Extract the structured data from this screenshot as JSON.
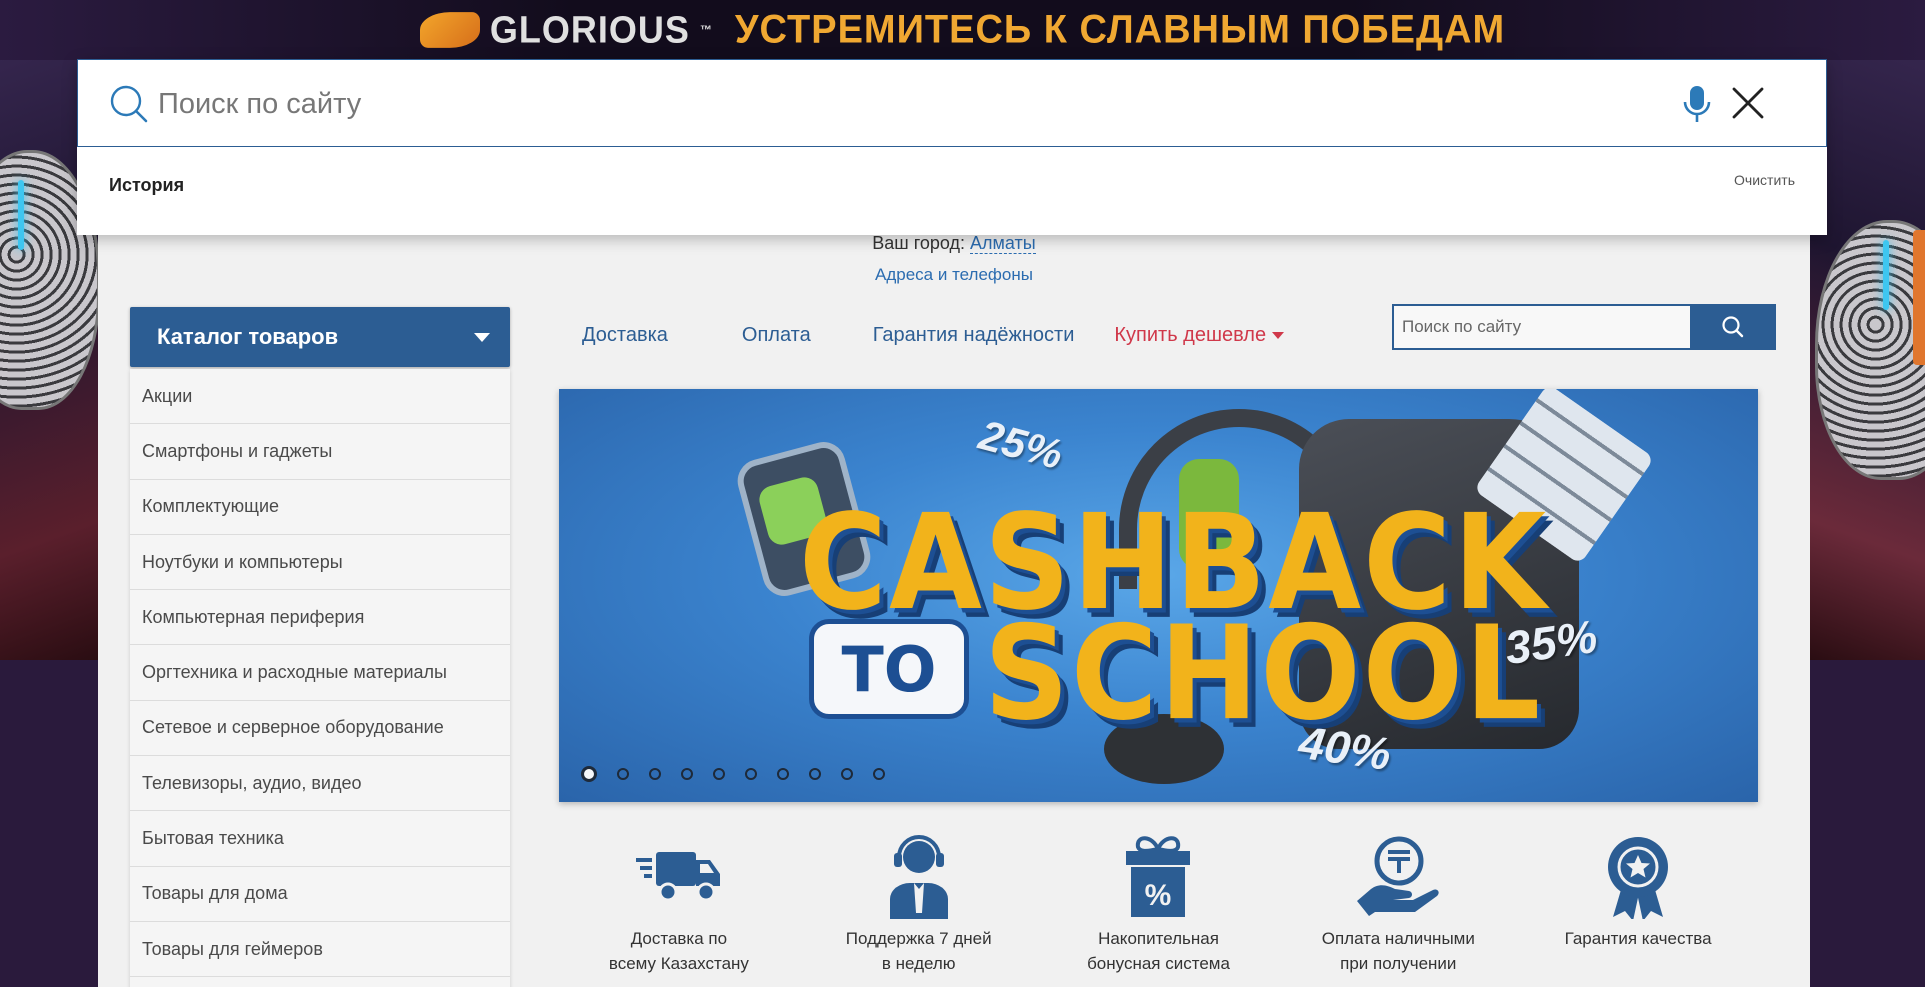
{
  "promo_banner": {
    "brand": "GLORIOUS",
    "trademark": "™",
    "slogan": "УСТРЕМИТЕСЬ К СЛАВНЫМ ПОБЕДАМ"
  },
  "search_overlay": {
    "placeholder": "Поиск по сайту",
    "value": "",
    "history_label": "История",
    "clear_label": "Очистить",
    "icons": [
      "search-icon",
      "microphone-icon",
      "close-icon"
    ]
  },
  "header": {
    "city_prefix": "Ваш город:",
    "city_name": "Алматы",
    "addresses_link": "Адреса и телефоны"
  },
  "catalog": {
    "button_label": "Каталог товаров",
    "items": [
      "Акции",
      "Смартфоны и гаджеты",
      "Комплектующие",
      "Ноутбуки и компьютеры",
      "Компьютерная периферия",
      "Оргтехника и расходные материалы",
      "Сетевое и серверное оборудование",
      "Телевизоры, аудио, видео",
      "Бытовая техника",
      "Товары для дома",
      "Товары для геймеров"
    ]
  },
  "nav": {
    "delivery": "Доставка",
    "payment": "Оплата",
    "guarantee": "Гарантия надёжности",
    "buy_cheaper": "Купить дешевле"
  },
  "mini_search": {
    "placeholder": "Поиск по сайту"
  },
  "hero_slider": {
    "headline_1": "CASHBACK",
    "headline_to": "TO",
    "headline_2": "SCHOOL",
    "discounts": [
      "25%",
      "35%",
      "40%"
    ],
    "slide_count": 10,
    "active_slide": 1
  },
  "features": [
    {
      "label": "Доставка по\nвсему Казахстану",
      "icon": "truck-icon"
    },
    {
      "label": "Поддержка 7 дней\nв неделю",
      "icon": "support-agent-icon"
    },
    {
      "label": "Накопительная\nбонусная система",
      "icon": "gift-percent-icon"
    },
    {
      "label": "Оплата наличными\nпри получении",
      "icon": "cash-hand-icon"
    },
    {
      "label": "Гарантия качества",
      "icon": "quality-badge-icon"
    }
  ],
  "colors": {
    "primary": "#2c5d93",
    "accent_red": "#d0384a",
    "promo_orange": "#f0a832"
  }
}
